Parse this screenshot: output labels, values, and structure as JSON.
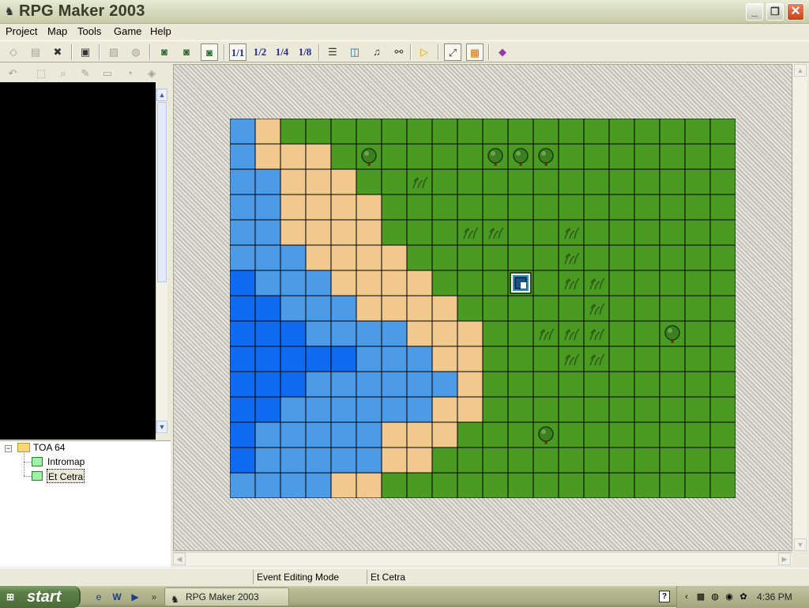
{
  "window": {
    "title": "RPG Maker 2003",
    "icon": "rpg-maker-icon",
    "controls": [
      "minimize-icon",
      "maximize-icon",
      "close-icon"
    ]
  },
  "menu": [
    "Project",
    "Map",
    "Tools",
    "Game",
    "Help"
  ],
  "toolbar": {
    "scales": [
      "1/1",
      "1/2",
      "1/4",
      "1/8"
    ],
    "icons": [
      "new-project-icon",
      "open-project-icon",
      "close-project-icon",
      "save-icon",
      "cut-icon",
      "paste-icon",
      "lower-layer-icon",
      "upper-layer-icon",
      "event-layer-icon",
      "zoom-1-1-icon",
      "zoom-1-2-icon",
      "zoom-1-4-icon",
      "zoom-1-8-icon",
      "database-icon",
      "material-icon",
      "music-icon",
      "search-icon",
      "play-icon",
      "fullscreen-icon",
      "title-screen-icon",
      "help-book-icon"
    ]
  },
  "map_tree": {
    "root": "TOA 64",
    "items": [
      "Intromap",
      "Et Cetra"
    ],
    "selected": "Et Cetra"
  },
  "map": {
    "cols": 20,
    "rows": 15,
    "tiles": [
      "WSGGGGGGGGGGGGGGGGGG",
      "WSSSGGGGGGGGGGGGGGGG",
      "WWSSSGGGGGGGGGGGGGGG",
      "WWSSSSGGGGGGGGGGGGGG",
      "WWSSSSGGGGGGGGGGGGGG",
      "WWWSSSSGGGGGGGGGGGGG",
      "DWWWSSSSGGGGGGGGGGGG",
      "DDWWWSSSSGGGGGGGGGGG",
      "DDDWWWWSSSGGGGGGGGGG",
      "DDDDDWWWSSGGGGGGGGGG",
      "DDDWWWWWWSGGGGGGGGGG",
      "DDWWWWWWSSGGGGGGGGGG",
      "DWWWWWSSSGGGGGGGGGGG",
      "DWWWWWSSGGGGGGGGGGGG",
      "WWWWSSGGGGGGGGGGGGGG"
    ],
    "trees": [
      [
        5,
        1
      ],
      [
        10,
        1
      ],
      [
        11,
        1
      ],
      [
        12,
        1
      ],
      [
        17,
        8
      ],
      [
        12,
        12
      ]
    ],
    "grass_tufts": [
      [
        7,
        2
      ],
      [
        9,
        4
      ],
      [
        10,
        4
      ],
      [
        13,
        4
      ],
      [
        13,
        5
      ],
      [
        13,
        6
      ],
      [
        14,
        6
      ],
      [
        14,
        7
      ],
      [
        12,
        8
      ],
      [
        13,
        8
      ],
      [
        14,
        8
      ],
      [
        13,
        9
      ],
      [
        14,
        9
      ]
    ],
    "event": {
      "col": 11,
      "row": 6,
      "icon": "event-marker-icon"
    },
    "colors": {
      "grass": "#4b9a23",
      "sand": "#f1c98e",
      "water_light": "#4d9be6",
      "water_deep": "#0f6cf0",
      "grid": "#000000"
    }
  },
  "status": {
    "mode": "Event Editing Mode",
    "map_name": "Et Cetra"
  },
  "taskbar": {
    "start_label": "start",
    "task_label": "RPG Maker 2003",
    "clock": "4:36 PM",
    "quicklaunch": [
      "ie-icon",
      "word-icon",
      "media-player-icon"
    ],
    "tray_icons": [
      "help-icon",
      "back-icon",
      "network-icon",
      "globe-icon",
      "security-icon",
      "msn-icon"
    ]
  }
}
